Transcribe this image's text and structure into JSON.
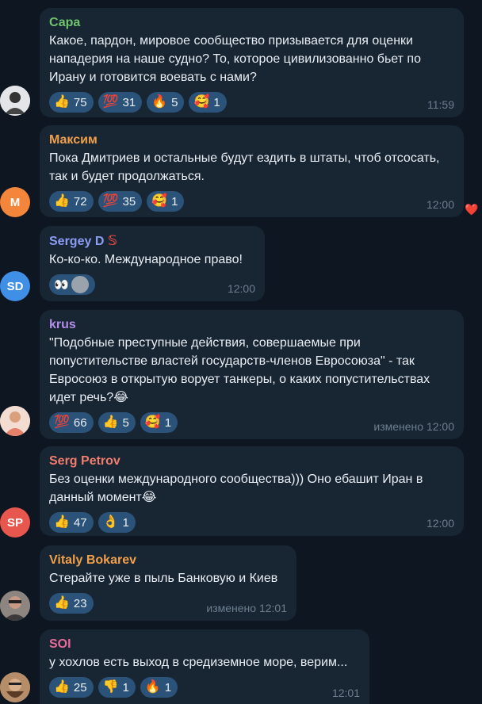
{
  "colors": {
    "bg": "#0e1621",
    "bubble": "#182533",
    "reaction_pill": "#2b5278",
    "meta": "#6d7f8f"
  },
  "messages": [
    {
      "sender": "Сара",
      "sender_color": "#6fc46e",
      "text": "Какое, пардон, мировое сообщество призывается для оценки нападерия на наше судно? То, которое цивилизованно бьет по Ирану и готовится воевать с нами?",
      "reactions": [
        {
          "icon": "thumbs-up",
          "emoji": "👍",
          "count": "75"
        },
        {
          "icon": "hundred",
          "emoji": "💯",
          "count": "31"
        },
        {
          "icon": "fire",
          "emoji": "🔥",
          "count": "5"
        },
        {
          "icon": "smiling-hearts",
          "emoji": "🥰",
          "count": "1"
        }
      ],
      "meta": "11:59",
      "avatar": {
        "type": "photo",
        "icon": "user-photo"
      }
    },
    {
      "sender": "Максим",
      "sender_color": "#f0a04b",
      "text": "Пока Дмитриев и остальные будут ездить в штаты, чтоб отсосать, так и будет продолжаться.",
      "reactions": [
        {
          "icon": "thumbs-up",
          "emoji": "👍",
          "count": "72"
        },
        {
          "icon": "hundred",
          "emoji": "💯",
          "count": "35"
        },
        {
          "icon": "smiling-hearts",
          "emoji": "🥰",
          "count": "1"
        }
      ],
      "meta": "12:00",
      "avatar": {
        "type": "initials",
        "initials": "M",
        "color": "#f4863b"
      },
      "side_reaction": "❤️"
    },
    {
      "sender": "Sergey D",
      "sender_badge": "𝕊",
      "sender_color": "#8d9df6",
      "text": "Ко-ко-ко. Международное право!",
      "reactions_special": "👀",
      "meta": "12:00",
      "avatar": {
        "type": "initials",
        "initials": "SD",
        "color": "#3f8fe6"
      }
    },
    {
      "sender": "krus",
      "sender_color": "#b28ee8",
      "text": "\"Подобные преступные действия, совершаемые при попустительстве властей государств-членов Евросоюза\" -  так Евросоюз в открытую ворует танкеры, о каких попустительствах идет речь?😂",
      "reactions": [
        {
          "icon": "hundred",
          "emoji": "💯",
          "count": "66"
        },
        {
          "icon": "thumbs-up",
          "emoji": "👍",
          "count": "5"
        },
        {
          "icon": "smiling-hearts",
          "emoji": "🥰",
          "count": "1"
        }
      ],
      "meta": "изменено 12:00",
      "avatar": {
        "type": "photo",
        "icon": "user-photo"
      }
    },
    {
      "sender": "Serg Petrov",
      "sender_color": "#f07e6e",
      "text": "Без оценки международного сообщества))) Оно ебашит Иран в данный момент😂",
      "reactions": [
        {
          "icon": "thumbs-up",
          "emoji": "👍",
          "count": "47"
        },
        {
          "icon": "ok-hand",
          "emoji": "👌",
          "count": "1"
        }
      ],
      "meta": "12:00",
      "avatar": {
        "type": "initials",
        "initials": "SP",
        "color": "#e8574e"
      }
    },
    {
      "sender": "Vitaly Bokarev",
      "sender_color": "#f0a04b",
      "text": "Стерайте уже в пыль Банковую и Киев",
      "reactions": [
        {
          "icon": "thumbs-up",
          "emoji": "👍",
          "count": "23"
        }
      ],
      "meta": "изменено 12:01",
      "avatar": {
        "type": "photo",
        "icon": "user-photo"
      }
    },
    {
      "sender": "SOI",
      "sender_color": "#e86a9a",
      "text": "у хохлов есть выход в средиземное море, верим...",
      "reactions": [
        {
          "icon": "thumbs-up",
          "emoji": "👍",
          "count": "25"
        },
        {
          "icon": "thumbs-down",
          "emoji": "👎",
          "count": "1"
        },
        {
          "icon": "fire",
          "emoji": "🔥",
          "count": "1"
        }
      ],
      "meta": "12:01",
      "avatar": {
        "type": "photo",
        "icon": "user-photo"
      }
    }
  ]
}
